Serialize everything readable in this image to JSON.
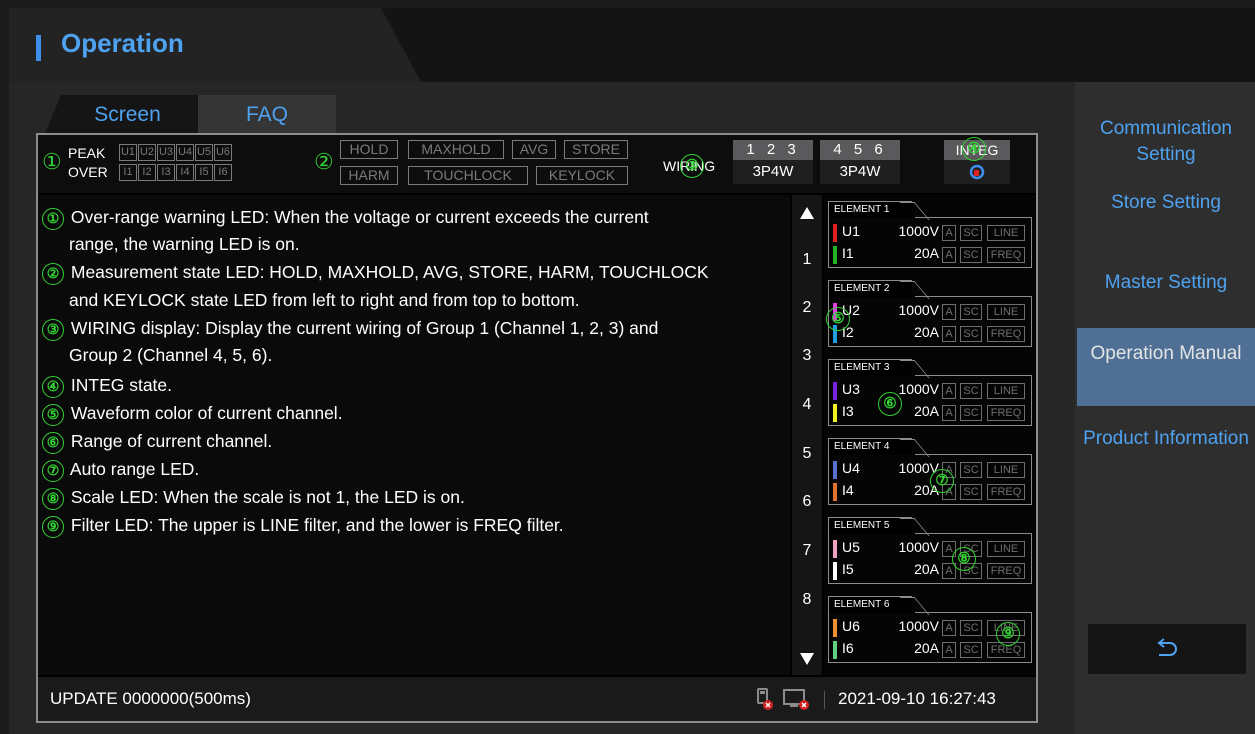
{
  "header": {
    "title": "Operation"
  },
  "tabs": [
    {
      "label": "Screen"
    },
    {
      "label": "FAQ"
    }
  ],
  "status": {
    "peak_label": "PEAK",
    "over_label": "OVER",
    "u_leds": [
      "U1",
      "U2",
      "U3",
      "U4",
      "U5",
      "U6"
    ],
    "i_leds": [
      "I1",
      "I2",
      "I3",
      "I4",
      "I5",
      "I6"
    ],
    "state_row1": [
      "HOLD",
      "MAXHOLD",
      "AVG",
      "STORE"
    ],
    "state_row2": [
      "HARM",
      "TOUCHLOCK",
      "KEYLOCK"
    ],
    "wiring_label": "WIRING",
    "group1_channels": "1 2 3",
    "group1_wiring": "3P4W",
    "group2_channels": "4 5 6",
    "group2_wiring": "3P4W",
    "integ_label": "INTEG",
    "integ_icon": "refresh-icon"
  },
  "markers": [
    "①",
    "②",
    "③",
    "④",
    "⑤",
    "⑥",
    "⑦",
    "⑧",
    "⑨"
  ],
  "descriptions": [
    "Over-range warning LED: When the voltage or current exceeds the current",
    "range, the warning LED is on.",
    "Measurement state LED: HOLD, MAXHOLD, AVG, STORE, HARM, TOUCHLOCK",
    "and KEYLOCK state LED from left to right and from top to bottom.",
    "WIRING display: Display the current wiring of Group 1 (Channel 1, 2, 3) and",
    "Group 2 (Channel 4, 5, 6).",
    "INTEG state.",
    "Waveform color of current channel.",
    "Range of current channel.",
    "Auto range LED.",
    "Scale LED: When the scale is not 1, the LED is on.",
    "Filter LED: The upper is LINE filter, and the lower is FREQ filter."
  ],
  "row_numbers": [
    "1",
    "2",
    "3",
    "4",
    "5",
    "6",
    "7",
    "8"
  ],
  "elements": [
    {
      "title": "ELEMENT 1",
      "u_name": "U1",
      "u_range": "1000V",
      "i_name": "I1",
      "i_range": "20A",
      "u_color": "#e02020",
      "i_color": "#22b024"
    },
    {
      "title": "ELEMENT 2",
      "u_name": "U2",
      "u_range": "1000V",
      "i_name": "I2",
      "i_range": "20A",
      "u_color": "#e040e0",
      "i_color": "#20a0e0"
    },
    {
      "title": "ELEMENT 3",
      "u_name": "U3",
      "u_range": "1000V",
      "i_name": "I3",
      "i_range": "20A",
      "u_color": "#7a20e0",
      "i_color": "#f0f020"
    },
    {
      "title": "ELEMENT 4",
      "u_name": "U4",
      "u_range": "1000V",
      "i_name": "I4",
      "i_range": "20A",
      "u_color": "#5a70d0",
      "i_color": "#e07030"
    },
    {
      "title": "ELEMENT 5",
      "u_name": "U5",
      "u_range": "1000V",
      "i_name": "I5",
      "i_range": "20A",
      "u_color": "#f0a0c0",
      "i_color": "#ffffff"
    },
    {
      "title": "ELEMENT 6",
      "u_name": "U6",
      "u_range": "1000V",
      "i_name": "I6",
      "i_range": "20A",
      "u_color": "#f09030",
      "i_color": "#60d080"
    }
  ],
  "tags": {
    "auto": "A",
    "scale": "SC",
    "line": "LINE",
    "freq": "FREQ"
  },
  "footer": {
    "update": "UPDATE 0000000(500ms)",
    "datetime": "2021-09-10 16:27:43"
  },
  "menu": [
    {
      "label": "Communication Setting"
    },
    {
      "label": "Store Setting"
    },
    {
      "label": "Master Setting"
    },
    {
      "label": "Operation Manual"
    },
    {
      "label": "Product Information"
    }
  ],
  "colors": {
    "accent": "#4ea2f0",
    "active_menu": "#4f6f95",
    "marker_green": "#33d233"
  }
}
